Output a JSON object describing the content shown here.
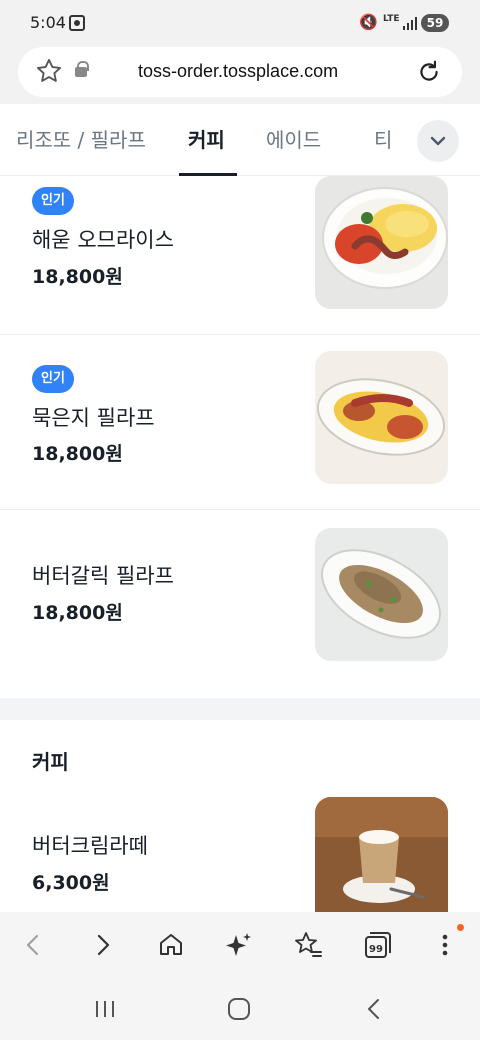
{
  "status_bar": {
    "time": "5:04",
    "network": "LTE",
    "battery": "59"
  },
  "browser": {
    "url": "toss-order.tossplace.com"
  },
  "tabs": [
    {
      "label": "리조또 / 필라프",
      "active": false
    },
    {
      "label": "커피",
      "active": true
    },
    {
      "label": "에이드",
      "active": false
    },
    {
      "label": "티",
      "active": false
    }
  ],
  "menu_items": [
    {
      "badge": "인기",
      "name": "해욷 오므라이스",
      "price": "18,800원"
    },
    {
      "badge": "인기",
      "name": "묵은지 필라프",
      "price": "18,800원"
    },
    {
      "badge": "",
      "name": "버터갈릭 필라프",
      "price": "18,800원"
    }
  ],
  "coffee_section": {
    "title": "커피",
    "items": [
      {
        "name": "버터크림라떼",
        "price": "6,300원"
      }
    ]
  },
  "colors": {
    "accent": "#3182f6",
    "text": "#191f28",
    "muted": "#6b7684",
    "notification_dot": "#f26522"
  },
  "icons": {
    "bookmark": "star-icon",
    "lock": "lock-icon",
    "reload": "reload-icon",
    "expand": "chevron-down-icon",
    "back": "chevron-left-icon",
    "forward": "chevron-right-icon",
    "home": "home-icon",
    "ai": "sparkle-icon",
    "bookmarks": "star-list-icon",
    "tabs": "tabs-icon",
    "menu": "more-vertical-icon"
  }
}
